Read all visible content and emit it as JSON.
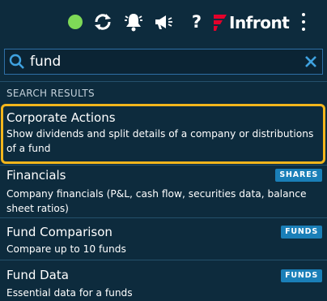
{
  "colors": {
    "background": "#0d2b3d",
    "status_online": "#7ed957",
    "accent_highlight": "#f2b51c",
    "badge": "#1a7fb8",
    "brand_red": "#e4002b"
  },
  "toolbar": {
    "status_icon": "online-status-dot",
    "sync_icon": "sync-icon",
    "notifications_icon": "bell-icon",
    "announcements_icon": "megaphone-icon",
    "help_label": "?",
    "brand_name": "Infront",
    "menu_icon": "kebab-menu-icon"
  },
  "search": {
    "icon": "search-icon",
    "value": "fund",
    "clear_icon": "close-icon"
  },
  "results": {
    "section_title": "SEARCH RESULTS",
    "items": [
      {
        "title": "Corporate Actions",
        "description": "Show dividends and split details of a company or distributions of a fund",
        "badge": "",
        "highlighted": true
      },
      {
        "title": "Financials",
        "description": "Company financials (P&L, cash flow, securities data, balance sheet ratios)",
        "badge": "SHARES",
        "highlighted": false
      },
      {
        "title": "Fund Comparison",
        "description": "Compare up to 10 funds",
        "badge": "FUNDS",
        "highlighted": false
      },
      {
        "title": "Fund Data",
        "description": "Essential data for a funds",
        "badge": "FUNDS",
        "highlighted": false
      }
    ]
  }
}
